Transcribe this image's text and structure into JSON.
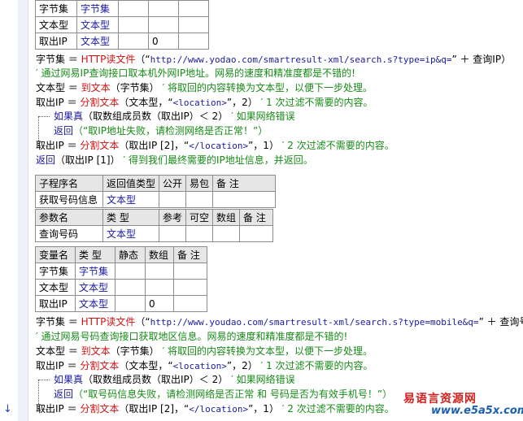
{
  "table_top": {
    "rows": [
      {
        "name": "字节集",
        "type": "字节集",
        "static": "",
        "array": "",
        "note": ""
      },
      {
        "name": "文本型",
        "type": "文本型",
        "static": "",
        "array": "",
        "note": ""
      },
      {
        "name": "取出IP",
        "type": "文本型",
        "static": "",
        "array": "0",
        "note": ""
      }
    ]
  },
  "code1": {
    "l1": {
      "a": "字节集 ＝ ",
      "b": "HTTP读文件",
      "c": "（“",
      "d": "http://www.yodao.com/smartresult-xml/search.s?type=ip&q=",
      "e": "” ＋ 查询IP）"
    },
    "l2": "′ 通过网易IP查询接口取本机外网IP地址。网易的速度和精准度都是不错的!",
    "l3": {
      "a": "文本型 ＝ ",
      "b": "到文本",
      "c": "（字节集）",
      "d": " ′ 将取回的内容转换为文本型，以便下一步处理。"
    },
    "l4": {
      "a": "取出IP ＝ ",
      "b": "分割文本",
      "c": "（文本型，“",
      "d": "<location>",
      "e": "”，2）",
      "f": " ′ 1 次过滤不需要的内容。"
    },
    "l5": {
      "a": "如果真",
      "b": "（取数组成员数（取出IP）＜ 2）",
      "c": " ′ 如果网络错误"
    },
    "l6": {
      "a": "返回",
      "b": "（“取IP地址失败，请检测网络是否正常！”）"
    },
    "l7": {
      "a": "取出IP ＝ ",
      "b": "分割文本",
      "c": "（取出IP [2]，“",
      "d": "</location>",
      "e": "”，1）",
      "f": " ′ 2 次过滤不需要的内容。"
    },
    "l8": {
      "a": "返回",
      "b": "（取出IP [1]）",
      "c": " ′ 得到我们最终需要的IP地址信息，并返回。"
    }
  },
  "sub": {
    "headers": [
      "子程序名",
      "返回值类型",
      "公开",
      "易包",
      "备 注"
    ],
    "row": {
      "name": "获取号码信息",
      "ret": "文本型",
      "pub": "",
      "pkg": "",
      "note": ""
    },
    "param_headers": [
      "参数名",
      "类 型",
      "参考",
      "可空",
      "数组",
      "备 注"
    ],
    "param_row": {
      "name": "查询号码",
      "type": "文本型",
      "ref": "",
      "nullable": "",
      "array": "",
      "note": ""
    }
  },
  "vars": {
    "headers": [
      "变量名",
      "类 型",
      "静态",
      "数组",
      "备 注"
    ],
    "rows": [
      {
        "name": "字节集",
        "type": "字节集",
        "static": "",
        "array": "",
        "note": ""
      },
      {
        "name": "文本型",
        "type": "文本型",
        "static": "",
        "array": "",
        "note": ""
      },
      {
        "name": "取出IP",
        "type": "文本型",
        "static": "",
        "array": "0",
        "note": ""
      }
    ]
  },
  "code2": {
    "l1": {
      "a": "字节集 ＝ ",
      "b": "HTTP读文件",
      "c": "（“",
      "d": "http://www.youdao.com/smartresult-xml/search.s?type=mobile&q=",
      "e": "” ＋ 查询号码）"
    },
    "l2": "′ 通过网易号码查询接口获取地区信息。网易的速度和精准度都是不错的!",
    "l3": {
      "a": "文本型 ＝ ",
      "b": "到文本",
      "c": "（字节集）",
      "d": " ′ 将取回的内容转换为文本型，以便下一步处理。"
    },
    "l4": {
      "a": "取出IP ＝ ",
      "b": "分割文本",
      "c": "（文本型，“",
      "d": "<location>",
      "e": "”，2）",
      "f": " ′ 1 次过滤不需要的内容。"
    },
    "l5": {
      "a": "如果真",
      "b": "（取数组成员数（取出IP）＜ 2）",
      "c": " ′ 如果网络错误"
    },
    "l6": {
      "a": "返回",
      "b": "（“取号码信息失败，请检测网络是否正常 和 号码是否为有效手机号！”）"
    },
    "l7": {
      "a": "取出IP ＝ ",
      "b": "分割文本",
      "c": "（取出IP [2]，“",
      "d": "</location>",
      "e": "”，1）",
      "f": " ′ 2 次过滤不需要的内容。"
    }
  },
  "watermark": {
    "cn": "易语言资源网",
    "url": "www.e5a5x.com"
  },
  "colors": {
    "keyword": "#d11111",
    "comment": "#178a17",
    "type": "#1a1aa0",
    "header_bg": "#e6e6e6"
  }
}
